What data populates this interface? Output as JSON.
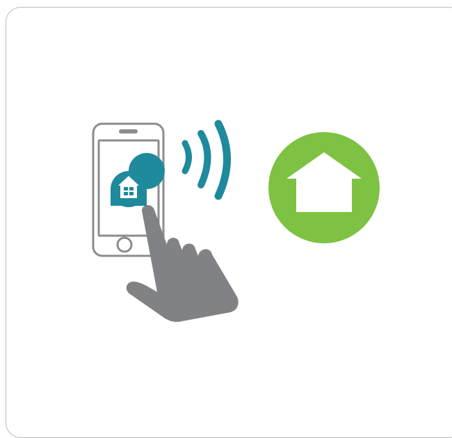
{
  "illustration": {
    "subject": "phone-tap-wifi-to-home",
    "icons": [
      "smartphone-icon",
      "app-home-icon",
      "hand-pointer-icon",
      "wireless-signal-icon",
      "home-icon"
    ],
    "colors": {
      "phone_outline": "#8a8c8e",
      "phone_screen": "#ffffff",
      "app_icon": "#1e8a9c",
      "signal": "#1e8a9c",
      "hand": "#808285",
      "home_circle": "#7dc242",
      "home_shape": "#ffffff",
      "card_border": "#b9bbbd"
    }
  }
}
